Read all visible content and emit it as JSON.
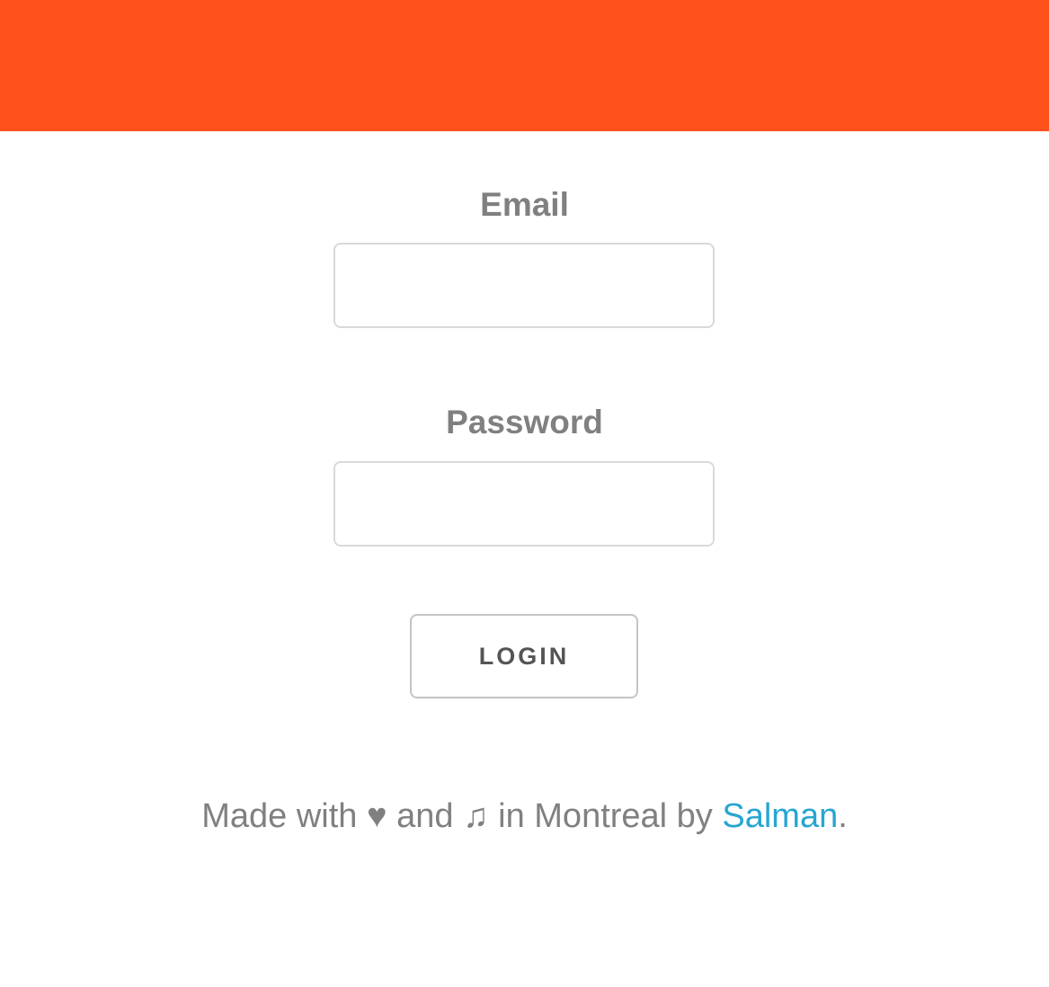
{
  "colors": {
    "header_bg": "#ff511c",
    "label_text": "#808080",
    "input_border": "#d9d9d9",
    "button_border": "#c4c4c4",
    "button_text": "#555555",
    "link": "#26a6d1"
  },
  "form": {
    "email_label": "Email",
    "email_value": "",
    "email_placeholder": "",
    "password_label": "Password",
    "password_value": "",
    "password_placeholder": "",
    "login_label": "LOGIN"
  },
  "footer": {
    "prefix": "Made with",
    "heart_icon": "heart-icon",
    "heart_glyph": "♥",
    "middle": "and",
    "music_icon": "music-note-icon",
    "music_glyph": "♫",
    "suffix": "in Montreal by",
    "author_link": "Salman",
    "end": "."
  }
}
